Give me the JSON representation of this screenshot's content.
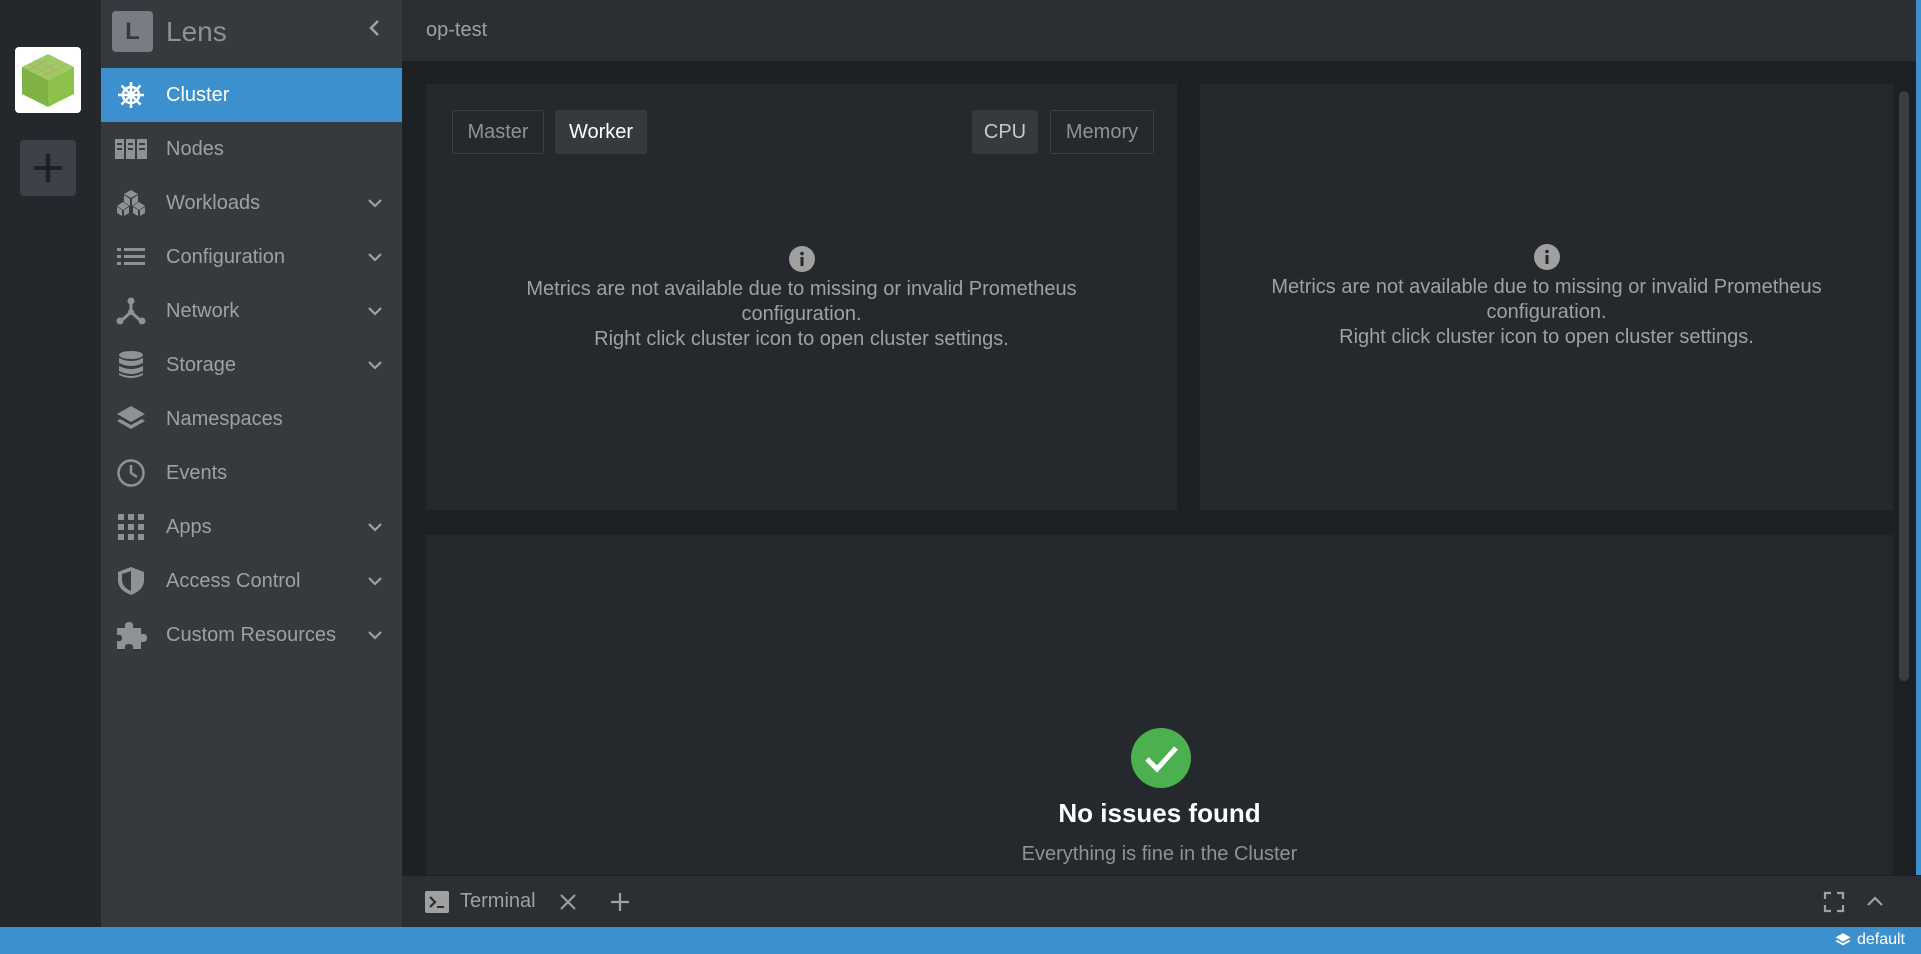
{
  "sidebar": {
    "logo_letter": "L",
    "app_name": "Lens",
    "items": [
      {
        "label": "Cluster",
        "icon": "helm-wheel-icon",
        "active": true,
        "expandable": false
      },
      {
        "label": "Nodes",
        "icon": "nodes-icon",
        "active": false,
        "expandable": false
      },
      {
        "label": "Workloads",
        "icon": "cubes-icon",
        "active": false,
        "expandable": true
      },
      {
        "label": "Configuration",
        "icon": "list-icon",
        "active": false,
        "expandable": true
      },
      {
        "label": "Network",
        "icon": "network-icon",
        "active": false,
        "expandable": true
      },
      {
        "label": "Storage",
        "icon": "database-icon",
        "active": false,
        "expandable": true
      },
      {
        "label": "Namespaces",
        "icon": "layers-icon",
        "active": false,
        "expandable": false
      },
      {
        "label": "Events",
        "icon": "clock-icon",
        "active": false,
        "expandable": false
      },
      {
        "label": "Apps",
        "icon": "apps-grid-icon",
        "active": false,
        "expandable": true
      },
      {
        "label": "Access Control",
        "icon": "shield-icon",
        "active": false,
        "expandable": true
      },
      {
        "label": "Custom Resources",
        "icon": "puzzle-icon",
        "active": false,
        "expandable": true
      }
    ]
  },
  "topbar": {
    "title": "op-test"
  },
  "metrics": {
    "tabs": {
      "master": "Master",
      "worker": "Worker",
      "cpu": "CPU",
      "memory": "Memory"
    },
    "message_line1": "Metrics are not available due to missing or invalid Prometheus",
    "message_line2": "configuration.",
    "message_line3": "Right click cluster icon to open cluster settings."
  },
  "issues": {
    "title": "No issues found",
    "subtitle": "Everything is fine in the Cluster"
  },
  "dock": {
    "terminal_label": "Terminal"
  },
  "statusbar": {
    "namespace": "default"
  },
  "colors": {
    "accent": "#3d90ce",
    "success": "#4caf50"
  }
}
